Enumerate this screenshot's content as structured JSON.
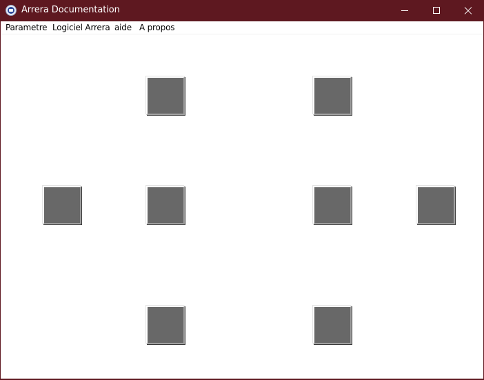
{
  "window": {
    "title": "Arrera Documentation",
    "title_bar_color": "#5e1820",
    "icon": "arrera-app-icon"
  },
  "controls": {
    "minimize_icon": "minimize-icon",
    "maximize_icon": "maximize-icon",
    "close_icon": "close-icon"
  },
  "menu": {
    "items": [
      "Parametre",
      "Logiciel Arrera",
      "aide",
      "A propos"
    ]
  },
  "content": {
    "tile_color": "#686868",
    "tile_count": 8
  }
}
